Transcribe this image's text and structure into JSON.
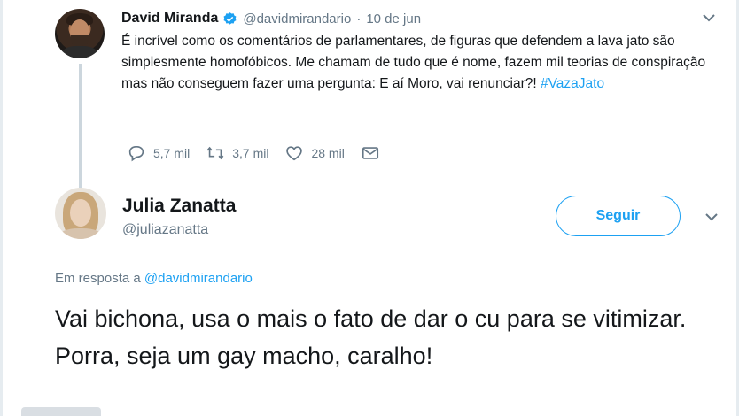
{
  "tweet1": {
    "author_name": "David Miranda",
    "handle": "@davidmirandario",
    "separator": "·",
    "date": "10 de jun",
    "text_main": "É incrível como os comentários de parlamentares,  de figuras que defendem a lava jato são simplesmente homofóbicos.  Me chamam de tudo que é nome, fazem mil teorias de conspiração mas não conseguem fazer uma pergunta: E aí Moro,  vai renunciar?! ",
    "hashtag": "#VazaJato",
    "replies": "5,7 mil",
    "retweets": "3,7 mil",
    "likes": "28 mil"
  },
  "tweet2": {
    "author_name": "Julia Zanatta",
    "handle": "@juliazanatta",
    "follow_label": "Seguir",
    "reply_prefix": "Em resposta a ",
    "reply_mention": "@davidmirandario",
    "text": "Vai bichona, usa o mais o fato de dar o cu para se vitimizar. Porra, seja um gay macho, caralho!"
  },
  "colors": {
    "accent": "#1da1f2",
    "muted": "#657786",
    "text": "#14171a",
    "thread_line": "#ccd6dd"
  },
  "icons": {
    "verified": "verified-badge-icon",
    "caret": "chevron-down-icon",
    "reply": "reply-icon",
    "retweet": "retweet-icon",
    "like": "heart-icon",
    "dm": "envelope-icon"
  }
}
